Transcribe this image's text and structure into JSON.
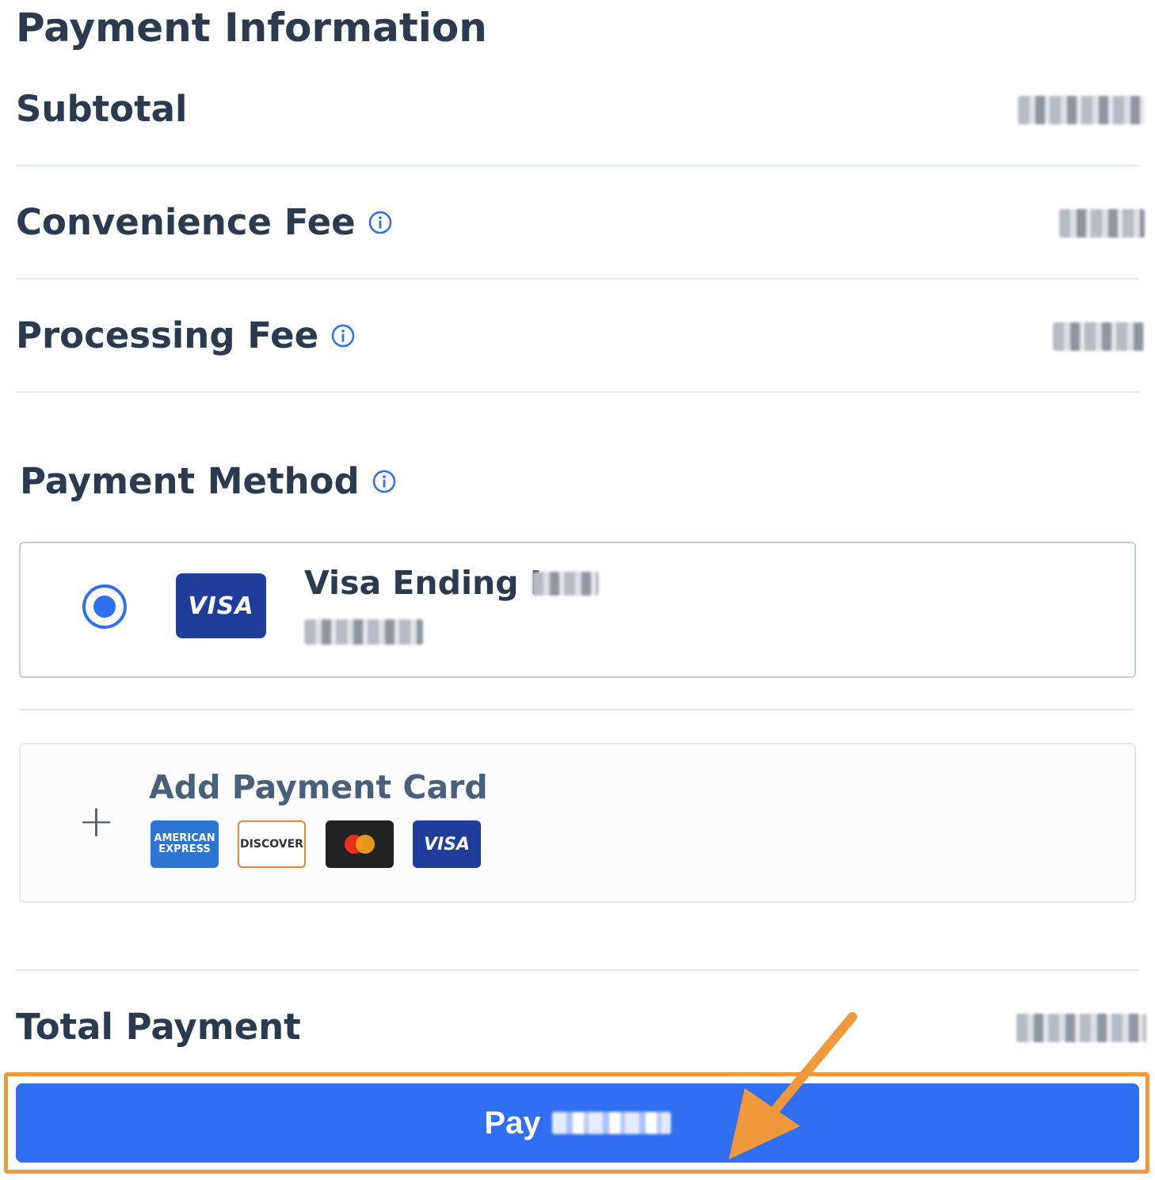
{
  "page": {
    "title": "Payment Information"
  },
  "summary": {
    "subtotal_label": "Subtotal",
    "convenience_fee_label": "Convenience Fee",
    "processing_fee_label": "Processing Fee"
  },
  "payment_method": {
    "heading": "Payment Method",
    "saved_card": {
      "label": "Visa Ending In",
      "brand": "VISA",
      "selected": true
    },
    "add_card": {
      "label": "Add Payment Card",
      "plus": "+",
      "brands": [
        "AMERICAN EXPRESS",
        "DISCOVER",
        "mastercard-logo",
        "VISA"
      ]
    }
  },
  "total": {
    "label": "Total Payment"
  },
  "pay_button": {
    "label": "Pay"
  },
  "icons": {
    "info": "info-icon",
    "plus": "plus-icon",
    "annotation": "arrow-annotation"
  },
  "colors": {
    "primary": "#2f6ff0",
    "highlight": "#f0993a",
    "visa_blue": "#1e3e9a",
    "text": "#2b3a4d"
  }
}
